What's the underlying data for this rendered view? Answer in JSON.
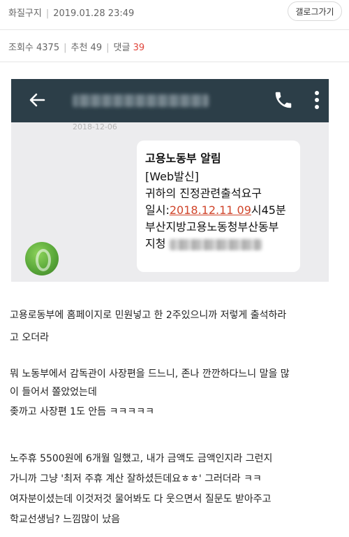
{
  "header": {
    "board_name": "화질구지",
    "datetime": "2019.01.28 23:49",
    "gallery_button": "갤로그가기"
  },
  "stats": {
    "views_label": "조회수 4375",
    "recommend_label": "추천 49",
    "comments_label": "댓글",
    "comments_count": "39"
  },
  "screenshot": {
    "date_ghost": "2018-12-06",
    "message": {
      "title": "고용노동부 알림",
      "line1": "[Web발신]",
      "line2": "귀하의 진정관련출석요구",
      "line3_prefix": "일시:",
      "line3_link": "2018.12.11 09",
      "line3_suffix": "시45분",
      "line4": "부산지방고용노동청부산동부",
      "line5": "지청"
    },
    "icons": [
      "back-arrow-icon",
      "phone-icon",
      "more-vert-icon"
    ]
  },
  "post": {
    "p1_l1": "고용로동부에 홈페이지로 민원넣고 한 2주있으니까 저렇게 출석하라",
    "p1_l2": "고 오더라",
    "p2_l1": "뭐 노동부에서 감독관이 사장편을 드느니, 존나 깐깐하다느니 말을 많",
    "p2_l2": "이 들어서 쫄았었는데",
    "p2_l3": "좆까고 사장편 1도 안듬 ㅋㅋㅋㅋㅋ",
    "p3_l1": "노주휴 5500원에 6개월 일했고, 내가 금액도 금액인지라 그런지",
    "p3_l2": "가니까 그냥  '최저 주휴 계산 잘하셨든데요ㅎㅎ' 그러더라 ㅋㅋ",
    "p3_l3": "여자분이셨는데 이것저것 물어봐도 다 웃으면서 질문도 받아주고",
    "p3_l4": "학교선생님? 느낌많이 났음"
  },
  "colors": {
    "accent_red": "#e0463c",
    "toolbar": "#2c3e48",
    "link_red": "#d0452b"
  }
}
